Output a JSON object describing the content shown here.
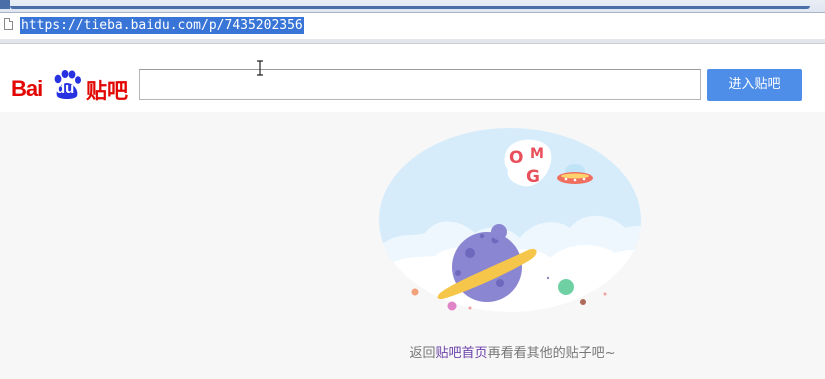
{
  "browser": {
    "url": "https://tieba.baidu.com/p/7435202356"
  },
  "logo": {
    "bai": "Bai",
    "du": "du",
    "tieba": "贴吧"
  },
  "search": {
    "value": "",
    "placeholder": ""
  },
  "enter_button_label": "进入贴吧",
  "illustration": {
    "badge_text": "OMG"
  },
  "notice": {
    "prefix": "返回",
    "link": "贴吧首页",
    "suffix": "再看看其他的贴子吧~"
  },
  "colors": {
    "brand_red": "#e10601",
    "brand_blue": "#2932e1",
    "button_blue": "#4e8ee8",
    "link_purple": "#6a3fa8"
  }
}
